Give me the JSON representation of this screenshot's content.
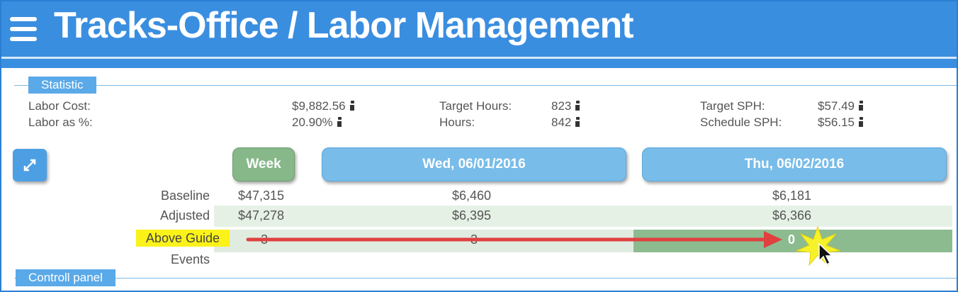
{
  "app": {
    "title": "Tracks-Office / Labor Management"
  },
  "sections": {
    "statistic": "Statistic",
    "control_panel": "Controll panel"
  },
  "stats": {
    "labor_cost_label": "Labor Cost:",
    "labor_cost_value": "$9,882.56",
    "labor_pct_label": "Labor as %:",
    "labor_pct_value": "20.90%",
    "target_hours_label": "Target Hours:",
    "target_hours_value": "823",
    "hours_label": "Hours:",
    "hours_value": "842",
    "target_sph_label": "Target SPH:",
    "target_sph_value": "$57.49",
    "schedule_sph_label": "Schedule SPH:",
    "schedule_sph_value": "$56.15"
  },
  "tabs": {
    "week": "Week",
    "day1": "Wed, 06/01/2016",
    "day2": "Thu, 06/02/2016"
  },
  "rows": {
    "baseline": {
      "label": "Baseline",
      "week": "$47,315",
      "day1": "$6,460",
      "day2": "$6,181"
    },
    "adjusted": {
      "label": "Adjusted",
      "week": "$47,278",
      "day1": "$6,395",
      "day2": "$6,366"
    },
    "above_guide": {
      "label": "Above Guide",
      "week": "3",
      "day1": "3",
      "day2": "0"
    },
    "events": {
      "label": "Events"
    }
  },
  "colors": {
    "header": "#3a8ee0",
    "week_tab": "#86b889",
    "day_tab": "#78bce9",
    "adjusted_band": "#e6f1e6",
    "above_band": "#e1ece1",
    "above_highlight": "#8cbb8f",
    "annotation_label": "#fbf21a",
    "arrow": "#e04040"
  },
  "icons": {
    "menu": "menu-icon",
    "expand": "expand-icon",
    "info": "info-icon",
    "cursor": "mouse-cursor-icon"
  }
}
